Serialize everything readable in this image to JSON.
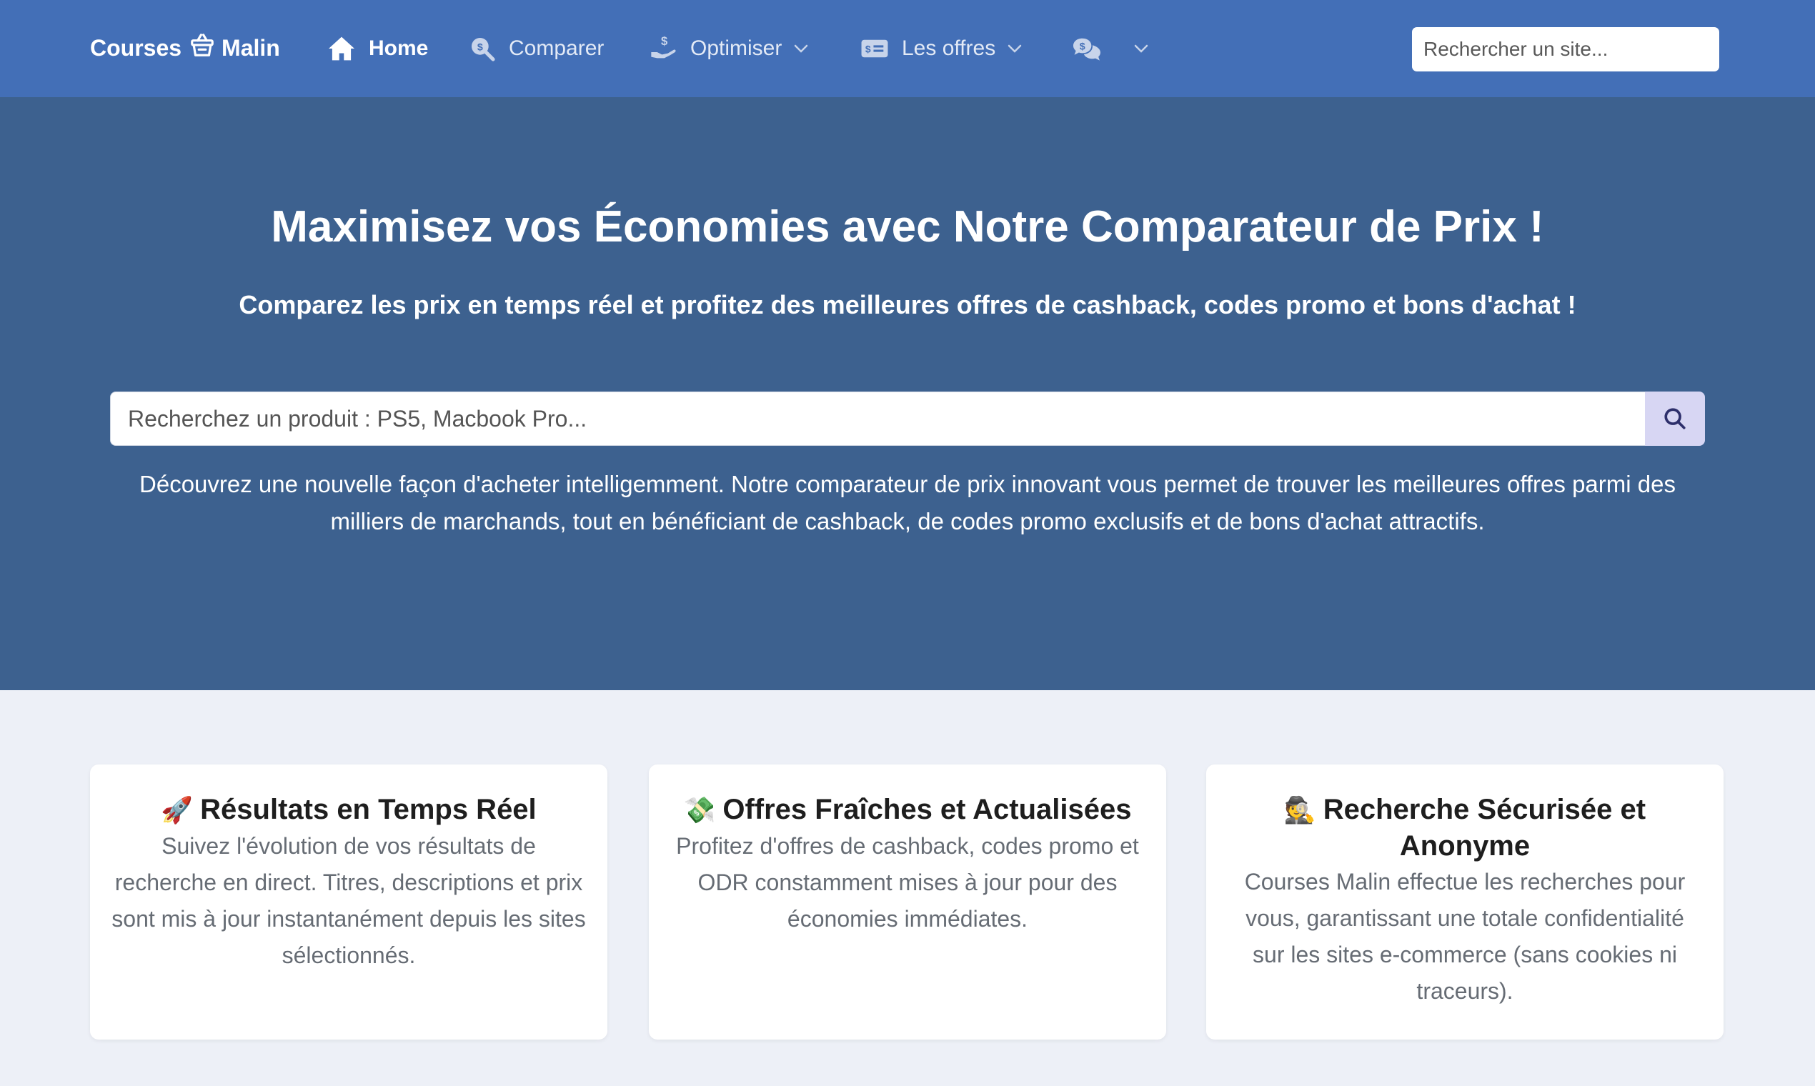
{
  "nav": {
    "brand_part1": "Courses",
    "brand_part2": "Malin",
    "items": [
      {
        "label": "Home",
        "icon": "home-icon",
        "active": true
      },
      {
        "label": "Comparer",
        "icon": "magnifier-dollar-icon"
      },
      {
        "label": "Optimiser",
        "icon": "hand-money-icon",
        "dropdown": true
      },
      {
        "label": "Les offres",
        "icon": "money-card-icon",
        "dropdown": true
      },
      {
        "label": "",
        "icon": "chat-dollar-icon",
        "dropdown": true
      }
    ],
    "search_placeholder": "Rechercher un site..."
  },
  "hero": {
    "title": "Maximisez vos Économies avec Notre Comparateur de Prix !",
    "subtitle": "Comparez les prix en temps réel et profitez des meilleures offres de cashback, codes promo et bons d'achat !",
    "search_placeholder": "Recherchez un produit : PS5, Macbook Pro...",
    "description": "Découvrez une nouvelle façon d'acheter intelligemment. Notre comparateur de prix innovant vous permet de trouver les meilleures offres parmi des milliers de marchands, tout en bénéficiant de cashback, de codes promo exclusifs et de bons d'achat attractifs."
  },
  "features": [
    {
      "emoji": "🚀",
      "title": "Résultats en Temps Réel",
      "text": "Suivez l'évolution de vos résultats de recherche en direct. Titres, descriptions et prix sont mis à jour instantanément depuis les sites sélectionnés."
    },
    {
      "emoji": "💸",
      "title": "Offres Fraîches et Actualisées",
      "text": "Profitez d'offres de cashback, codes promo et ODR constamment mises à jour pour des économies immédiates."
    },
    {
      "emoji": "🕵️",
      "title": "Recherche Sécurisée et Anonyme",
      "text": "Courses Malin effectue les recherches pour vous, garantissant une totale confidentialité sur les sites e-commerce (sans cookies ni traceurs)."
    }
  ],
  "colors": {
    "navbar": "#436fb7",
    "hero": "#3d618f",
    "page_bg": "#edf0f7",
    "search_button": "#d7d6f3"
  }
}
